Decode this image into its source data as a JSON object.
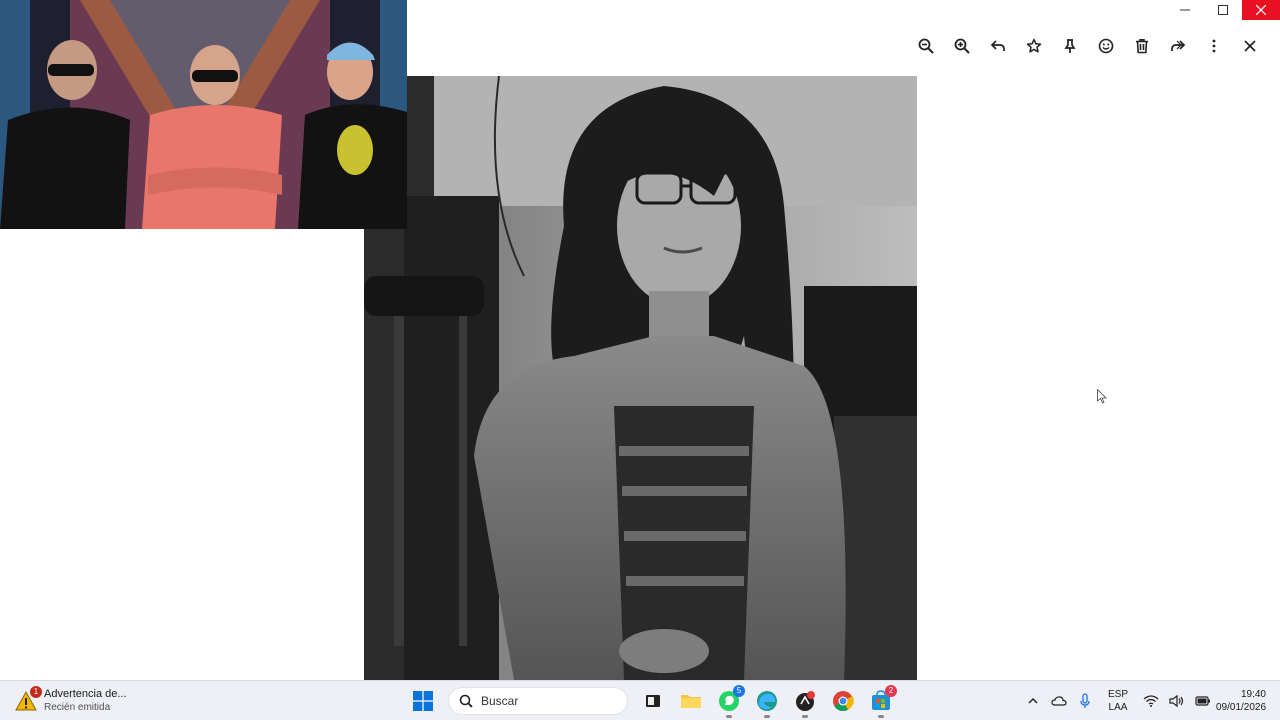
{
  "window": {
    "minimize_glyph": "—",
    "maximize_glyph": "☐",
    "close_glyph": "✕"
  },
  "toolbar": {
    "icons": [
      "zoom-out-icon",
      "zoom-in-icon",
      "reply-icon",
      "star-icon",
      "pin-icon",
      "emoji-icon",
      "delete-icon",
      "forward-icon",
      "more-icon",
      "close-icon"
    ]
  },
  "taskbar": {
    "notification": {
      "title": "Advertencia de...",
      "subtitle": "Recién emitida",
      "badge": "1"
    },
    "search": {
      "placeholder": "Buscar"
    },
    "apps": [
      {
        "name": "start-button",
        "badge": ""
      },
      {
        "name": "task-view",
        "badge": ""
      },
      {
        "name": "file-explorer",
        "badge": ""
      },
      {
        "name": "whatsapp",
        "badge": "5"
      },
      {
        "name": "edge",
        "badge": ""
      },
      {
        "name": "app-red-dot",
        "badge": ""
      },
      {
        "name": "chrome",
        "badge": ""
      },
      {
        "name": "store",
        "badge": "2"
      }
    ],
    "language": {
      "line1": "ESP",
      "line2": "LAA"
    },
    "clock": {
      "time": "19:40",
      "date": "09/01/2026"
    }
  },
  "colors": {
    "close_button": "#e81123",
    "taskbar": "#eef0f6",
    "badge_blue": "#1a73e8",
    "badge_red": "#c42b1c"
  }
}
